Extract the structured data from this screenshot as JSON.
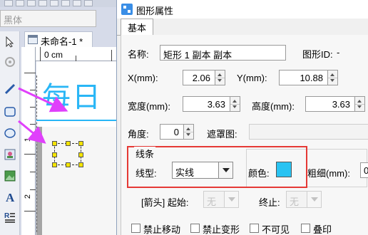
{
  "designer": {
    "font_combo_value": "黑体",
    "document_tab": "未命名-1 *",
    "ruler_unit": "0 cm",
    "ruler_left_marks": [
      "1",
      "2"
    ],
    "canvas_text": "每日",
    "colors": {
      "text": "#29b6f6",
      "arrow": "#e040fb",
      "handle": "#f4e400"
    }
  },
  "dialog": {
    "title": "图形属性",
    "tabs": [
      "基本"
    ],
    "name": {
      "label": "名称:",
      "value": "矩形 1 副本 副本"
    },
    "shape_id": {
      "label": "图形ID:",
      "value": "-"
    },
    "x": {
      "label": "X(mm):",
      "value": "2.06"
    },
    "y": {
      "label": "Y(mm):",
      "value": "10.88"
    },
    "width": {
      "label": "宽度(mm):",
      "value": "3.63"
    },
    "height": {
      "label": "高度(mm):",
      "value": "3.63"
    },
    "angle": {
      "label": "角度:",
      "value": "0"
    },
    "mask": {
      "label": "遮罩图:",
      "value": ""
    },
    "line": {
      "group_label": "线条",
      "type_label": "线型:",
      "type_value": "实线",
      "color_label": "颜色:",
      "color_value": "#29c3f2",
      "thickness_label": "粗细(mm):",
      "thickness_value": "0",
      "highlight_color": "#e53935"
    },
    "arrow": {
      "label": "[箭头] 起始:",
      "start_value": "无",
      "end_label": "终止:",
      "end_value": "无"
    },
    "checkboxes": [
      "禁止移动",
      "禁止变形",
      "不可见",
      "叠印"
    ]
  }
}
